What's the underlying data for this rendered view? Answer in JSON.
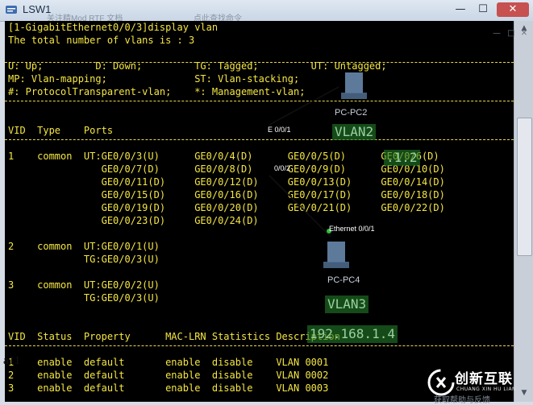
{
  "window": {
    "title": "LSW1",
    "ghost_title_left": "关注精Mod RTF 文档",
    "ghost_title_mid": "点此查找命令",
    "controls": {
      "minimize": "—",
      "maximize": "☐",
      "close": "✕"
    },
    "aux_buttons": [
      "—",
      "□",
      "✕"
    ]
  },
  "terminal": {
    "lines": [
      "[1-GigabitEthernet0/0/3]display vlan",
      "The total number of vlans is : 3",
      "",
      "U: Up;         D: Down;         TG: Tagged;         UT: Untagged;",
      "MP: Vlan-mapping;               ST: Vlan-stacking;",
      "#: ProtocolTransparent-vlan;    *: Management-vlan;",
      "",
      "",
      "VID  Type    Ports",
      "",
      "1    common  UT:GE0/0/3(U)      GE0/0/4(D)      GE0/0/5(D)      GE0/0/6(D)",
      "                GE0/0/7(D)      GE0/0/8(D)      GE0/0/9(D)      GE0/0/10(D)",
      "                GE0/0/11(D)     GE0/0/12(D)     GE0/0/13(D)     GE0/0/14(D)",
      "                GE0/0/15(D)     GE0/0/16(D)     GE0/0/17(D)     GE0/0/18(D)",
      "                GE0/0/19(D)     GE0/0/20(D)     GE0/0/21(D)     GE0/0/22(D)",
      "                GE0/0/23(D)     GE0/0/24(D)",
      "",
      "2    common  UT:GE0/0/1(U)",
      "             TG:GE0/0/3(U)",
      "",
      "3    common  UT:GE0/0/2(U)",
      "             TG:GE0/0/3(U)",
      "",
      "",
      "VID  Status  Property      MAC-LRN Statistics Description",
      "",
      "1    enable  default       enable  disable    VLAN 0001",
      "2    enable  default       enable  disable    VLAN 0002",
      "3    enable  default       enable  disable    VLAN 0003"
    ]
  },
  "topology_overlay": {
    "pc2_label": "PC-PC2",
    "pc4_label": "PC-PC4",
    "vlan2_label": "VLAN2",
    "vlan3_label": "VLAN3",
    "ip_fragment_top": ".1.2",
    "ip_bottom": "192.168.1.4",
    "port_e001": "E 0/0/1",
    "port_002": "0/0/2",
    "port_ethernet001": "Ethernet 0/0/1",
    "stray_char": "a11"
  },
  "watermark": {
    "brand": "创新互联",
    "sub": "CHUANG XIN HU LIAN"
  },
  "bottom_ghost_text": "获取帮助与反馈",
  "colors": {
    "terminal_bg": "#000000",
    "terminal_text": "#f5e642",
    "vlan_box": "#227828",
    "titlebar": "#c9d6e5",
    "close_button": "#c75050"
  }
}
